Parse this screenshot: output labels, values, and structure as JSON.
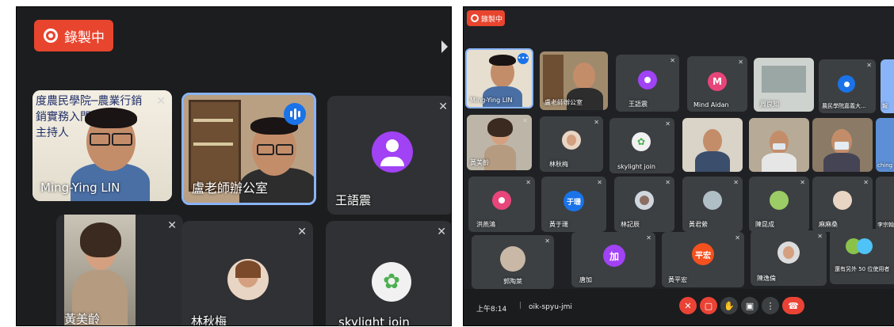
{
  "left": {
    "recording_label": "錄製中",
    "tiles": [
      {
        "name": "Ming-Ying LIN"
      },
      {
        "name": "盧老師辦公室"
      },
      {
        "name": "王語震"
      },
      {
        "name": "黃美齡"
      },
      {
        "name": "林秋梅"
      },
      {
        "name": "skylight join"
      }
    ]
  },
  "right": {
    "recording_label": "錄製中",
    "tiles": [
      {
        "name": "Ming-Ying LIN"
      },
      {
        "name": "盧老師辦公室"
      },
      {
        "name": "王語震"
      },
      {
        "name": "Mind Aidan",
        "initial": "M"
      },
      {
        "name": "周良知"
      },
      {
        "name": "農民學院嘉義大..."
      },
      {
        "name": "報"
      },
      {
        "name": "黃美齡"
      },
      {
        "name": "林秋梅"
      },
      {
        "name": "skylight join"
      },
      {
        "name": "ching"
      },
      {
        "name": "洪燕鴻"
      },
      {
        "name": "黃于珊",
        "initial": "于珊"
      },
      {
        "name": "林記辰"
      },
      {
        "name": "黃君縈"
      },
      {
        "name": "陳昆成"
      },
      {
        "name": "麻麻桑"
      },
      {
        "name": "李宗翰"
      },
      {
        "name": "郭陶萊"
      },
      {
        "name": "唐加",
        "initial": "加"
      },
      {
        "name": "黃平宏",
        "initial": "平宏"
      },
      {
        "name": "陳逸倫"
      },
      {
        "name": "還有另外 50 位使用者"
      }
    ],
    "time": "上午8:14",
    "meeting_code": "oik-spyu-jmi"
  },
  "colors": {
    "record": "#e8452f",
    "tile": "#3c4043",
    "speaking": "#1a73e8",
    "end_call": "#ea4335",
    "avatar_purple": "#a142f4",
    "avatar_pink": "#e8457a",
    "avatar_blue": "#1a73e8",
    "avatar_orange": "#f4511e"
  }
}
